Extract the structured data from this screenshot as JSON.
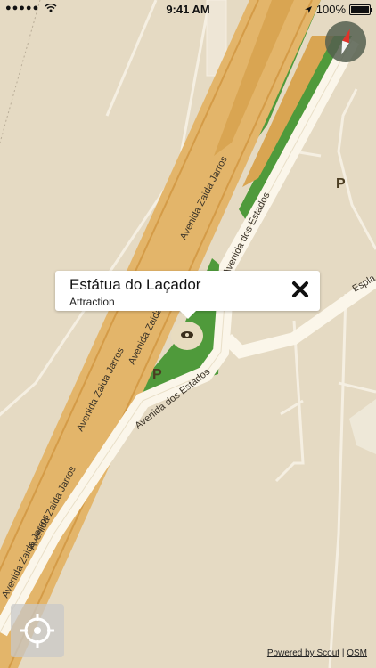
{
  "status_bar": {
    "time": "9:41 AM",
    "battery": "100%"
  },
  "poi": {
    "title": "Estátua do Laçador",
    "category": "Attraction"
  },
  "map_labels": {
    "avenida_zaida_jarros": "Avenida Zaida Jarros",
    "avenida_dos_estados": "Avenida dos Estados",
    "espla": "Espla",
    "parking": "P"
  },
  "attribution": {
    "powered_by": "Powered by Scout",
    "separator": "|",
    "osm": "OSM"
  },
  "colors": {
    "land": "#e5dac3",
    "park": "#4f9a3b",
    "highway": "#e3b56a",
    "road": "#fbf6ea"
  }
}
